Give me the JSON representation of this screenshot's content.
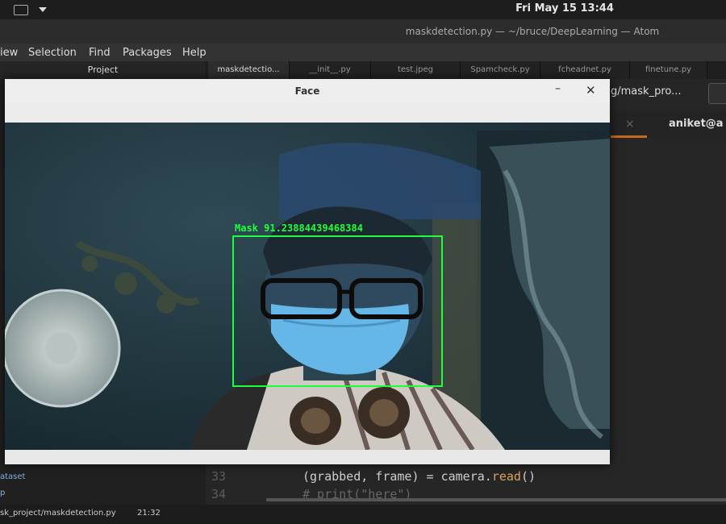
{
  "topbar": {
    "clock": "Fri May 15  13:44"
  },
  "atom": {
    "window_title": "maskdetection.py — ~/bruce/DeepLearning — Atom"
  },
  "menu": {
    "view": "iew",
    "selection": "Selection",
    "find": "Find",
    "packages": "Packages",
    "help": "Help"
  },
  "tree": {
    "header": "Project",
    "item_dataset": "ataset",
    "item_p": "p"
  },
  "tabs": [
    "maskdetectio...",
    "__init__.py",
    "test.jpeg",
    "Spamcheck.py",
    "fcheadnet.py",
    "finetune.py"
  ],
  "terminal": {
    "path": "g/mask_pro...",
    "close_glyph": "×",
    "name": "aniket@a"
  },
  "code": {
    "lines": [
      {
        "num": "33",
        "text": "(grabbed, frame) = camera.",
        "call": "read",
        "tail": "()"
      },
      {
        "num": "34",
        "comment": "# print(\"here\")"
      }
    ]
  },
  "status": {
    "path": "sk_project/maskdetection.py",
    "cursor": "21:32"
  },
  "face_window": {
    "title": "Face",
    "minimize_glyph": "–",
    "close_glyph": "✕",
    "detection_label": "Mask 91.23884439468384",
    "box_color": "#1dff3a"
  }
}
